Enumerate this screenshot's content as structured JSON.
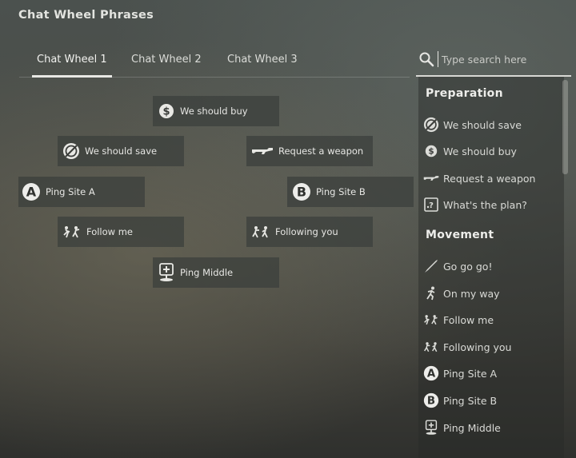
{
  "window": {
    "title": "Chat Wheel Phrases"
  },
  "tabs": [
    {
      "label": "Chat Wheel 1",
      "active": true
    },
    {
      "label": "Chat Wheel 2",
      "active": false
    },
    {
      "label": "Chat Wheel 3",
      "active": false
    }
  ],
  "search": {
    "placeholder": "Type search here",
    "value": ""
  },
  "wheel": [
    {
      "label": "We should buy",
      "icon": "dollar-icon"
    },
    {
      "label": "We should save",
      "icon": "no-money-icon"
    },
    {
      "label": "Request a weapon",
      "icon": "rifle-icon"
    },
    {
      "label": "Ping Site A",
      "icon": "site-a-icon"
    },
    {
      "label": "Ping Site B",
      "icon": "site-b-icon"
    },
    {
      "label": "Follow me",
      "icon": "follow-me-icon"
    },
    {
      "label": "Following you",
      "icon": "following-icon"
    },
    {
      "label": "Ping Middle",
      "icon": "middle-icon"
    }
  ],
  "sidebar": {
    "sections": [
      {
        "title": "Preparation",
        "items": [
          {
            "label": "We should save",
            "icon": "no-money-icon"
          },
          {
            "label": "We should buy",
            "icon": "dollar-icon"
          },
          {
            "label": "Request a weapon",
            "icon": "rifle-icon"
          },
          {
            "label": "What's the plan?",
            "icon": "plan-icon"
          }
        ]
      },
      {
        "title": "Movement",
        "items": [
          {
            "label": "Go go go!",
            "icon": "knife-icon"
          },
          {
            "label": "On my way",
            "icon": "running-icon"
          },
          {
            "label": "Follow me",
            "icon": "follow-me-icon"
          },
          {
            "label": "Following you",
            "icon": "following-icon"
          },
          {
            "label": "Ping Site A",
            "icon": "site-a-icon"
          },
          {
            "label": "Ping Site B",
            "icon": "site-b-icon"
          },
          {
            "label": "Ping Middle",
            "icon": "middle-icon"
          }
        ]
      }
    ]
  }
}
